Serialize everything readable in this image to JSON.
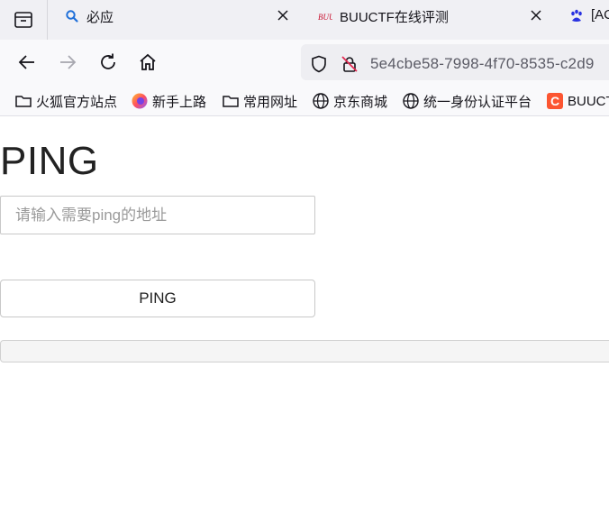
{
  "browser": {
    "tabs": [
      {
        "label": "必应",
        "icon": "search-icon"
      },
      {
        "label": "BUUCTF在线评测",
        "icon": "buuctf-favicon"
      },
      {
        "label": "[AC",
        "icon": "baidu-paw-icon"
      }
    ],
    "url": "5e4cbe58-7998-4f70-8535-c2d9",
    "bookmarks": [
      {
        "label": "火狐官方站点",
        "icon": "folder-icon"
      },
      {
        "label": "新手上路",
        "icon": "firefox-icon"
      },
      {
        "label": "常用网址",
        "icon": "folder-icon"
      },
      {
        "label": "京东商城",
        "icon": "globe-icon"
      },
      {
        "label": "统一身份认证平台",
        "icon": "globe-icon"
      },
      {
        "label": "BUUCT",
        "icon": "csdn-icon"
      }
    ]
  },
  "page": {
    "title": "PING",
    "input_placeholder": "请输入需要ping的地址",
    "input_value": "",
    "button_label": "PING",
    "result": ""
  },
  "colors": {
    "tabstrip_bg": "#f0f0f4",
    "toolbar_bg": "#f9f9fb",
    "csdn_red": "#fc5531",
    "baidu_blue": "#2932e1",
    "search_blue": "#1e6fd9"
  }
}
